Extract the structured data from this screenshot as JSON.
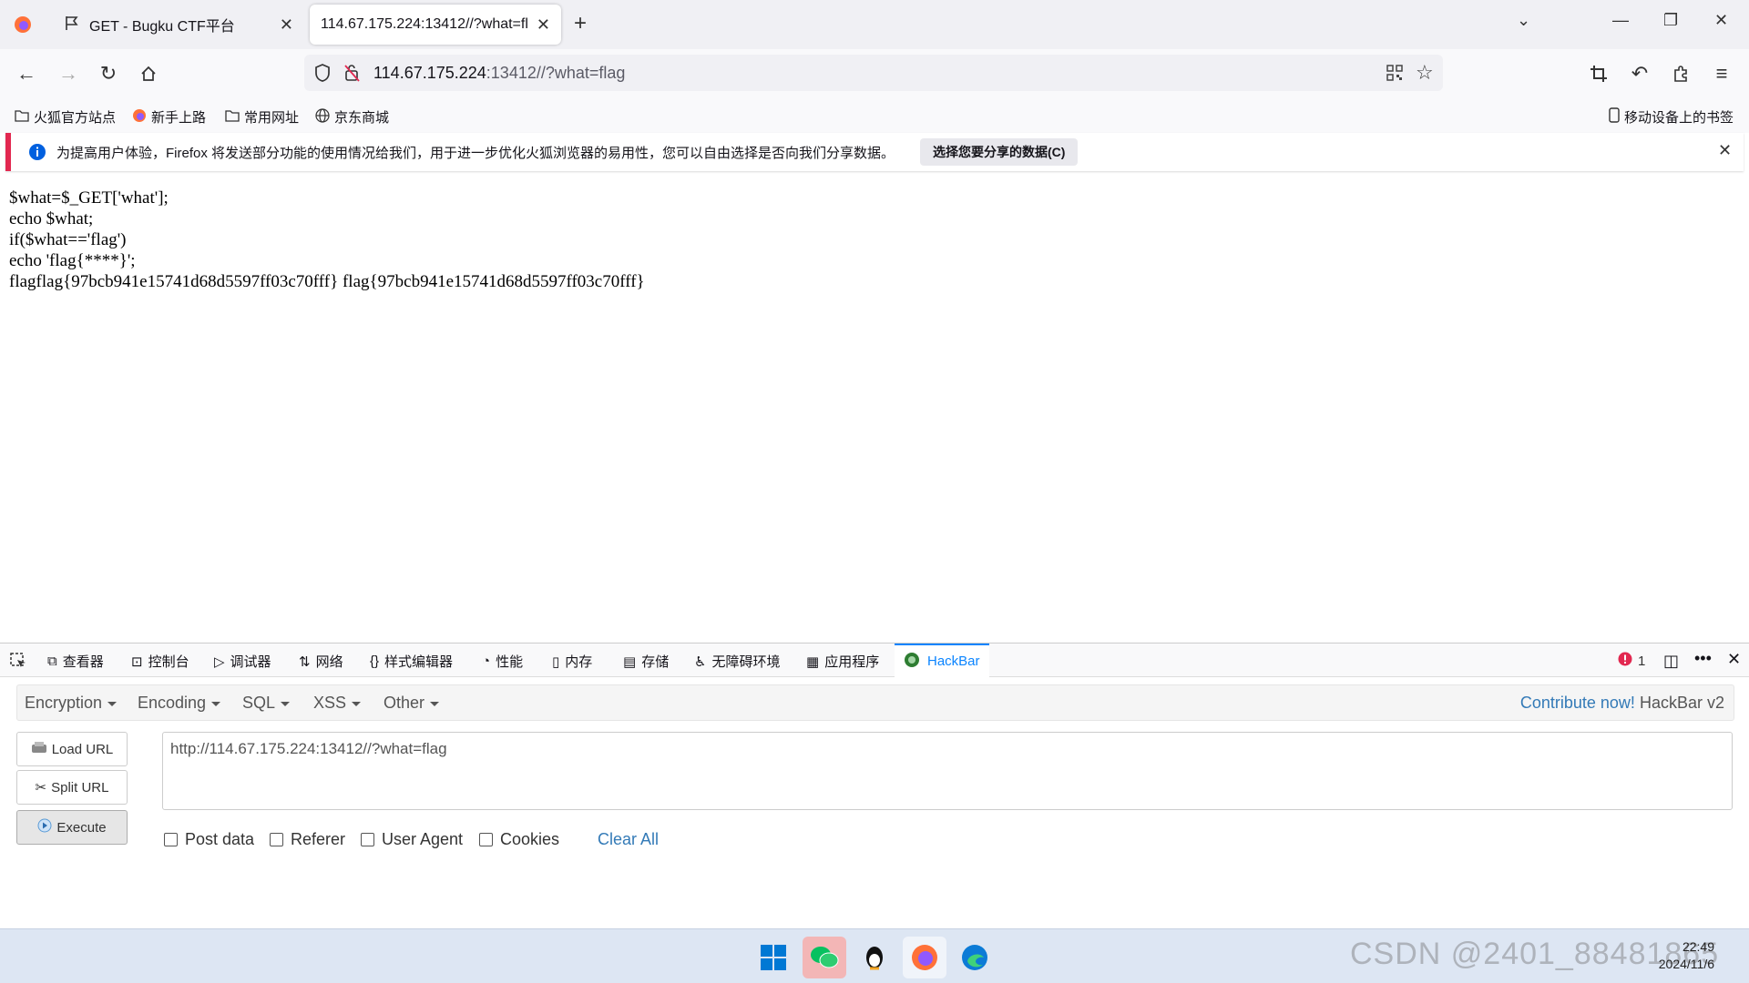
{
  "browser": {
    "tabs": [
      {
        "label": "GET - Bugku CTF平台",
        "icon": "flag-icon",
        "active": false
      },
      {
        "label": "114.67.175.224:13412//?what=fla",
        "active": true
      }
    ],
    "address": {
      "host": "114.67.175.224",
      "rest": ":13412//?what=flag"
    },
    "bookmarks": [
      {
        "label": "火狐官方站点",
        "icon": "folder-icon"
      },
      {
        "label": "新手上路",
        "icon": "firefox-icon"
      },
      {
        "label": "常用网址",
        "icon": "folder-icon"
      },
      {
        "label": "京东商城",
        "icon": "globe-icon"
      }
    ],
    "mobile_bookmarks": "移动设备上的书签",
    "notification": {
      "text": "为提高用户体验，Firefox 将发送部分功能的使用情况给我们，用于进一步优化火狐浏览器的易用性，您可以自由选择是否向我们分享数据。",
      "button": "选择您要分享的数据(C)"
    }
  },
  "page": {
    "lines": [
      "$what=$_GET['what'];",
      "echo $what;",
      "if($what=='flag')",
      "echo 'flag{****}';",
      "flagflag{97bcb941e15741d68d5597ff03c70fff} flag{97bcb941e15741d68d5597ff03c70fff}"
    ]
  },
  "devtools": {
    "tabs": [
      "查看器",
      "控制台",
      "调试器",
      "网络",
      "样式编辑器",
      "性能",
      "内存",
      "存储",
      "无障碍环境",
      "应用程序"
    ],
    "hackbar_tab": "HackBar",
    "error_count": "1"
  },
  "hackbar": {
    "menus": [
      "Encryption",
      "Encoding",
      "SQL",
      "XSS",
      "Other"
    ],
    "contribute": "Contribute now!",
    "version": "HackBar v2",
    "buttons": {
      "load": "Load URL",
      "split": "Split URL",
      "execute": "Execute"
    },
    "url_value": "http://114.67.175.224:13412//?what=flag",
    "checkboxes": [
      "Post data",
      "Referer",
      "User Agent",
      "Cookies"
    ],
    "clear_all": "Clear All"
  },
  "taskbar": {
    "watermark": "CSDN @2401_88481865",
    "time": "22:49",
    "date": "2024/11/6"
  },
  "colors": {
    "accent": "#0a84ff",
    "link": "#337ab7",
    "notif_bar": "#e22850"
  }
}
